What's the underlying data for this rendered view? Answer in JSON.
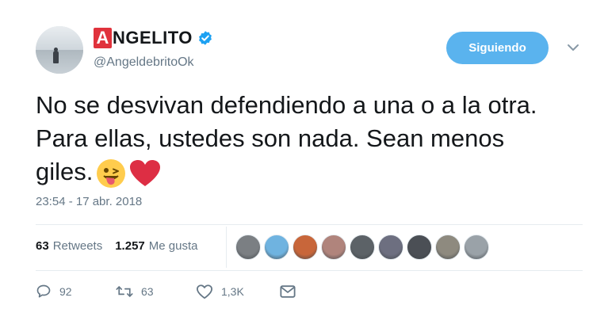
{
  "profile": {
    "display_name_initial": "A",
    "display_name_rest": "NGELITO",
    "handle": "@AngeldebritoOk",
    "verified": true
  },
  "follow_button": {
    "label": "Siguiendo"
  },
  "tweet": {
    "lines": [
      "No se desvivan defendiendo a una o a la otra.",
      "Para ellas, ustedes son nada. Sean menos",
      "giles."
    ],
    "emojis": [
      "winking-face-tongue-emoji",
      "red-heart-emoji"
    ],
    "timestamp": "23:54 - 17 abr. 2018"
  },
  "stats": {
    "retweets_count": "63",
    "retweets_label": "Retweets",
    "likes_count": "1.257",
    "likes_label": "Me gusta"
  },
  "liker_avatar_colors": [
    "#7b7f83",
    "#6fb3e0",
    "#c8663a",
    "#b0847c",
    "#5c6267",
    "#6d6f80",
    "#4b4f55",
    "#8e8a7f",
    "#9aa2a8"
  ],
  "actions": {
    "reply_count": "92",
    "retweet_count": "63",
    "like_count": "1,3K"
  },
  "colors": {
    "accent": "#5ab3ee",
    "brand_red": "#e0323c",
    "heart": "#e0245e",
    "secondary_text": "#657786"
  }
}
